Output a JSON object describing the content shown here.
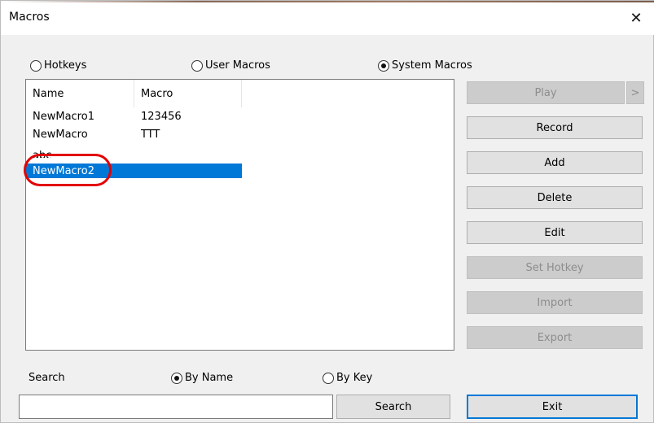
{
  "window": {
    "title": "Macros",
    "close_glyph": "✕"
  },
  "mode_options": [
    {
      "label": "Hotkeys",
      "selected": false
    },
    {
      "label": "User Macros",
      "selected": false
    },
    {
      "label": "System Macros",
      "selected": true
    }
  ],
  "list": {
    "columns": [
      "Name",
      "Macro"
    ],
    "rows": [
      {
        "name": "NewMacro1",
        "macro": "123456"
      },
      {
        "name": "NewMacro",
        "macro": "TTT"
      },
      {
        "name": "abc",
        "macro": ""
      },
      {
        "name": "NewMacro2",
        "macro": "",
        "selected": true
      }
    ],
    "selection_color": "#0078d7",
    "annotation_color": "#e30000"
  },
  "actions": {
    "play": {
      "label": "Play",
      "enabled": false
    },
    "play_more": {
      "label": ">",
      "enabled": false
    },
    "record": {
      "label": "Record",
      "enabled": true
    },
    "add": {
      "label": "Add",
      "enabled": true
    },
    "delete": {
      "label": "Delete",
      "enabled": true
    },
    "edit": {
      "label": "Edit",
      "enabled": true
    },
    "set_hotkey": {
      "label": "Set Hotkey",
      "enabled": false
    },
    "import": {
      "label": "Import",
      "enabled": false
    },
    "export": {
      "label": "Export",
      "enabled": false
    }
  },
  "search": {
    "label": "Search",
    "options": [
      {
        "label": "By Name",
        "selected": true
      },
      {
        "label": "By Key",
        "selected": false
      }
    ],
    "value": "",
    "button_label": "Search"
  },
  "exit_label": "Exit"
}
